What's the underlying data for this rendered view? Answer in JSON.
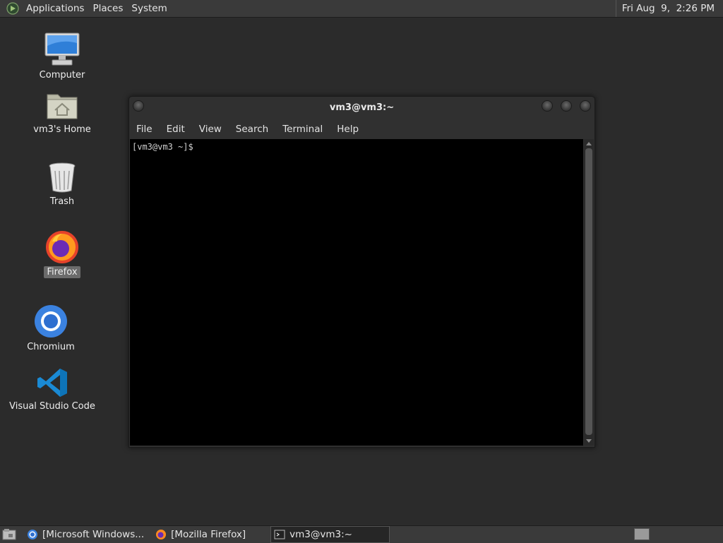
{
  "top_panel": {
    "menus": [
      "Applications",
      "Places",
      "System"
    ],
    "clock": "Fri Aug  9,  2:26 PM"
  },
  "desktop": {
    "icons": [
      {
        "label": "Computer",
        "icon": "computer-icon"
      },
      {
        "label": "vm3's Home",
        "icon": "home-folder-icon"
      },
      {
        "label": "Trash",
        "icon": "trash-icon"
      },
      {
        "label": "Firefox",
        "icon": "firefox-icon",
        "selected": true
      },
      {
        "label": "Chromium",
        "icon": "chromium-icon"
      },
      {
        "label": "Visual Studio Code",
        "icon": "vscode-icon"
      }
    ]
  },
  "terminal": {
    "title": "vm3@vm3:~",
    "menus": [
      "File",
      "Edit",
      "View",
      "Search",
      "Terminal",
      "Help"
    ],
    "prompt": "[vm3@vm3 ~]$"
  },
  "taskbar": {
    "tasks": [
      {
        "label": "[Microsoft Windows...",
        "icon": "chromium-icon",
        "active": false
      },
      {
        "label": "[Mozilla Firefox]",
        "icon": "firefox-icon",
        "active": false
      },
      {
        "label": "vm3@vm3:~",
        "icon": "terminal-icon",
        "active": true
      }
    ]
  },
  "colors": {
    "desktop_bg": "#2b2b2b",
    "panel_bg": "#3a3a3a",
    "terminal_bg": "#000000",
    "vscode_blue": "#1a8ad4",
    "chromium_blue": "#3b82e0"
  }
}
